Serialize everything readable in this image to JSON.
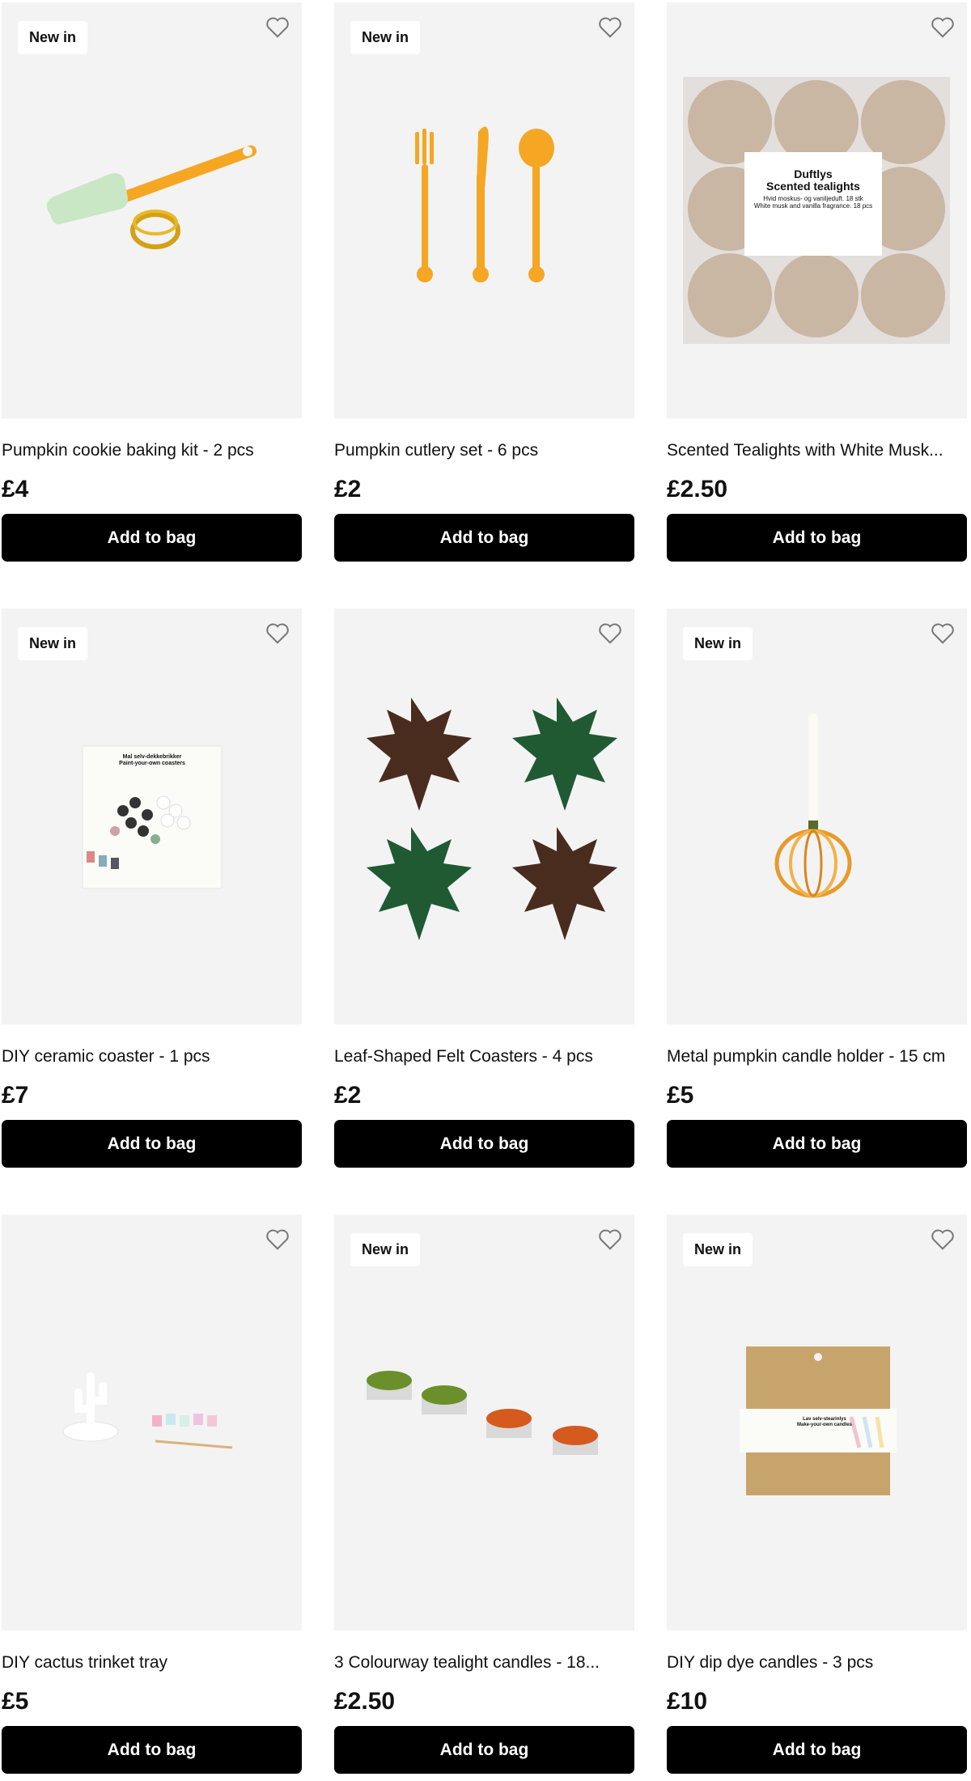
{
  "products": [
    {
      "title": "Pumpkin cookie baking kit - 2 pcs",
      "price": "£4",
      "badge": "New in",
      "button": "Add to bag",
      "image": "spatula-cutter"
    },
    {
      "title": "Pumpkin cutlery set - 6 pcs",
      "price": "£2",
      "badge": "New in",
      "button": "Add to bag",
      "image": "cutlery"
    },
    {
      "title": "Scented Tealights with White Musk...",
      "price": "£2.50",
      "badge": "",
      "button": "Add to bag",
      "image": "tealight-pack",
      "package_text": {
        "line1": "Duftlys",
        "line2": "Scented tealights",
        "line3": "Hvid moskus- og vaniljeduft. 18 stk",
        "line4": "White musk and vanilla fragrance. 18 pcs"
      }
    },
    {
      "title": "DIY ceramic coaster - 1 pcs",
      "price": "£7",
      "badge": "New in",
      "button": "Add to bag",
      "image": "coaster-kit",
      "package_text": {
        "line1": "Mal selv-dekkebrikker",
        "line2": "Paint-your-own coasters"
      }
    },
    {
      "title": "Leaf-Shaped Felt Coasters - 4 pcs",
      "price": "£2",
      "badge": "",
      "button": "Add to bag",
      "image": "leaf-coasters"
    },
    {
      "title": "Metal pumpkin candle holder - 15 cm",
      "price": "£5",
      "badge": "New in",
      "button": "Add to bag",
      "image": "pumpkin-holder"
    },
    {
      "title": "DIY cactus trinket tray",
      "price": "£5",
      "badge": "",
      "button": "Add to bag",
      "image": "cactus-tray"
    },
    {
      "title": "3 Colourway tealight candles - 18...",
      "price": "£2.50",
      "badge": "New in",
      "button": "Add to bag",
      "image": "tealights"
    },
    {
      "title": "DIY dip dye candles - 3 pcs",
      "price": "£10",
      "badge": "New in",
      "button": "Add to bag",
      "image": "dip-dye-kit",
      "package_text": {
        "line1": "Lav selv-stearinlys",
        "line2": "Make-your-own candles"
      }
    }
  ],
  "colors": {
    "button_bg": "#000000",
    "image_bg": "#f3f3f3",
    "orange": "#f5a623"
  }
}
